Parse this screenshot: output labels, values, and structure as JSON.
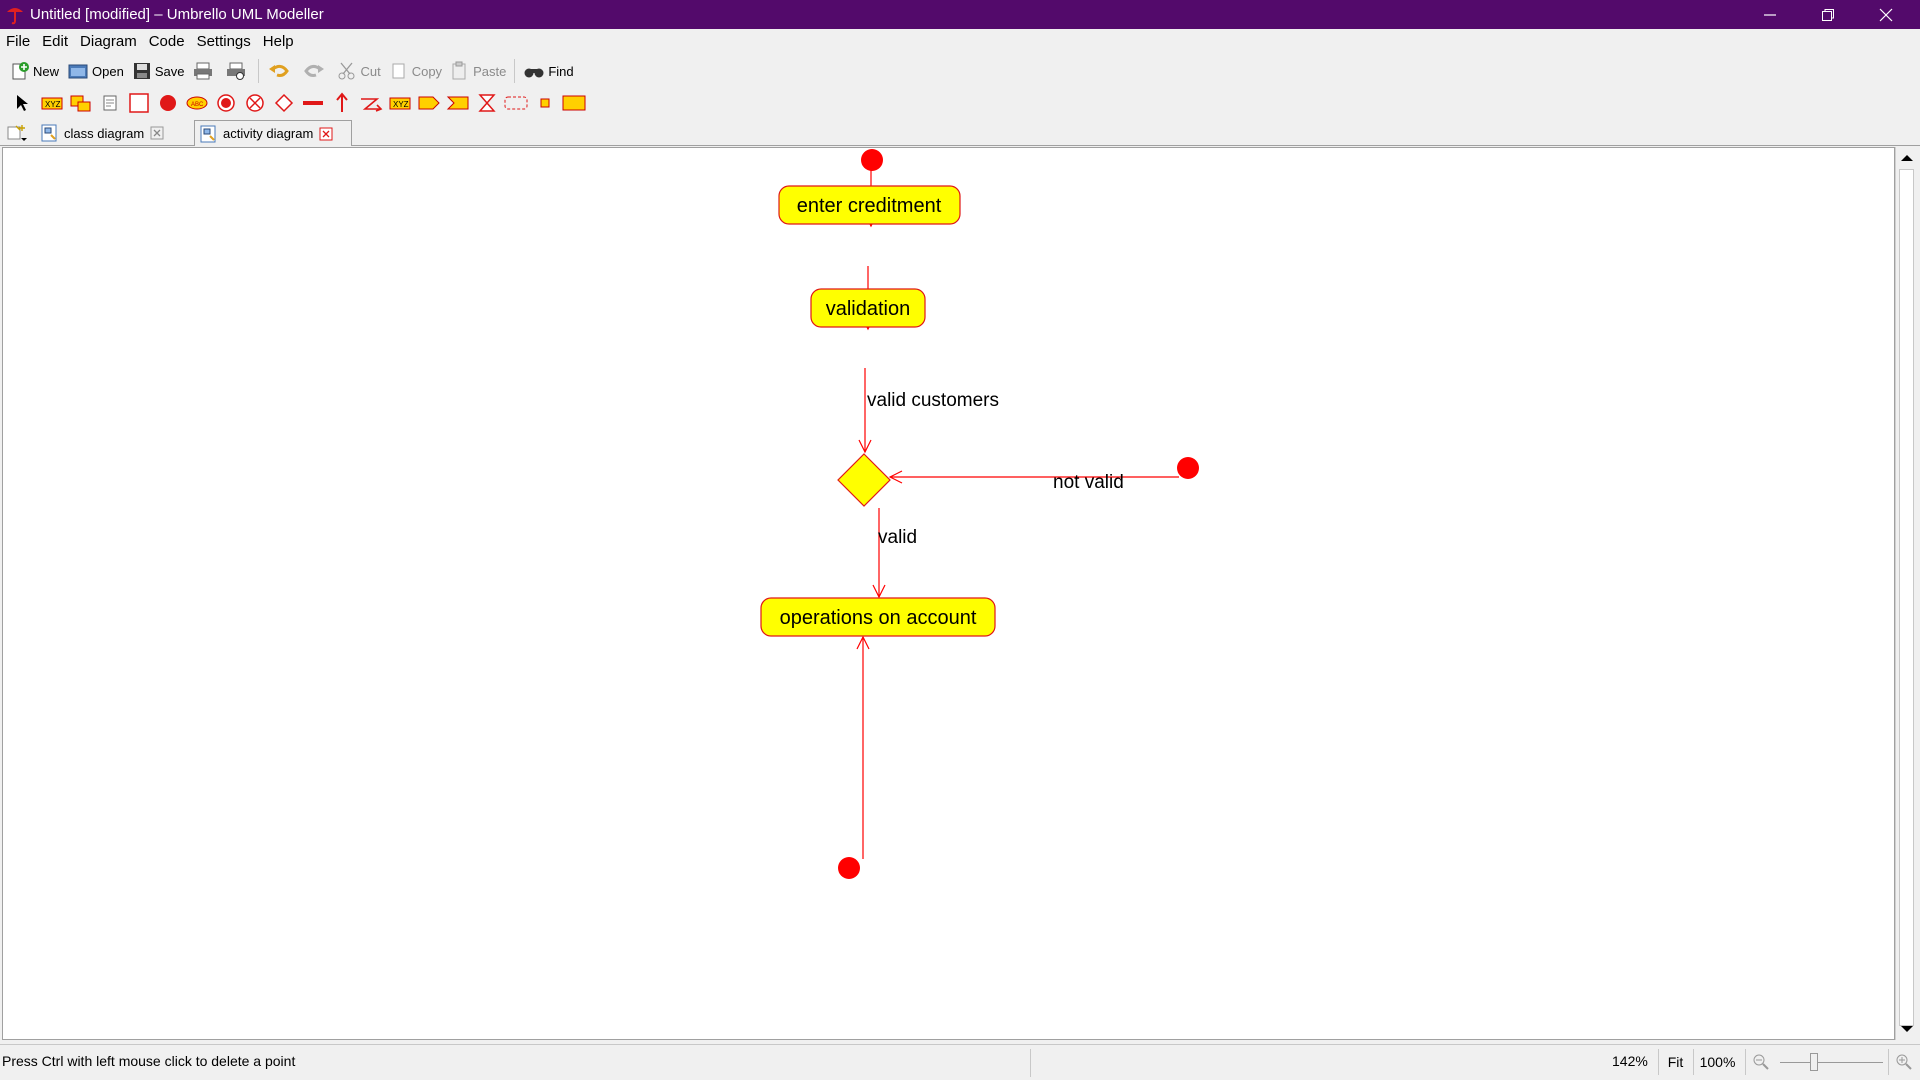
{
  "window": {
    "title": "Untitled [modified] – Umbrello UML Modeller",
    "controls": [
      "minimize",
      "restore",
      "close"
    ]
  },
  "menu": [
    "File",
    "Edit",
    "Diagram",
    "Code",
    "Settings",
    "Help"
  ],
  "toolbar": {
    "new": "New",
    "open": "Open",
    "save": "Save",
    "cut": "Cut",
    "copy": "Copy",
    "paste": "Paste",
    "find": "Find"
  },
  "diagram_tools": [
    "select-arrow",
    "object",
    "note",
    "anchor",
    "activity",
    "initial",
    "activity-text",
    "final-activity",
    "final-flow",
    "branch",
    "fork-join",
    "transition",
    "send-signal",
    "exception",
    "pin",
    "accept-signal",
    "accept-time",
    "region",
    "object-node",
    "box"
  ],
  "tabs": [
    {
      "label": "class diagram"
    },
    {
      "label": "activity diagram"
    }
  ],
  "diagram": {
    "nodes": {
      "enter": "enter creditment",
      "validation": "validation",
      "operations": "operations on account"
    },
    "edge_labels": {
      "valid_customers": "valid customers",
      "not_valid": "not valid",
      "valid": "valid"
    },
    "colors": {
      "node_fill": "#ffff00",
      "node_border": "#e01818",
      "edge": "#ff0000",
      "initial": "#ff0000"
    }
  },
  "status": {
    "message": "Press Ctrl with left mouse click to delete a point",
    "zoom": "142%",
    "fit": "Fit",
    "hundred": "100%"
  }
}
